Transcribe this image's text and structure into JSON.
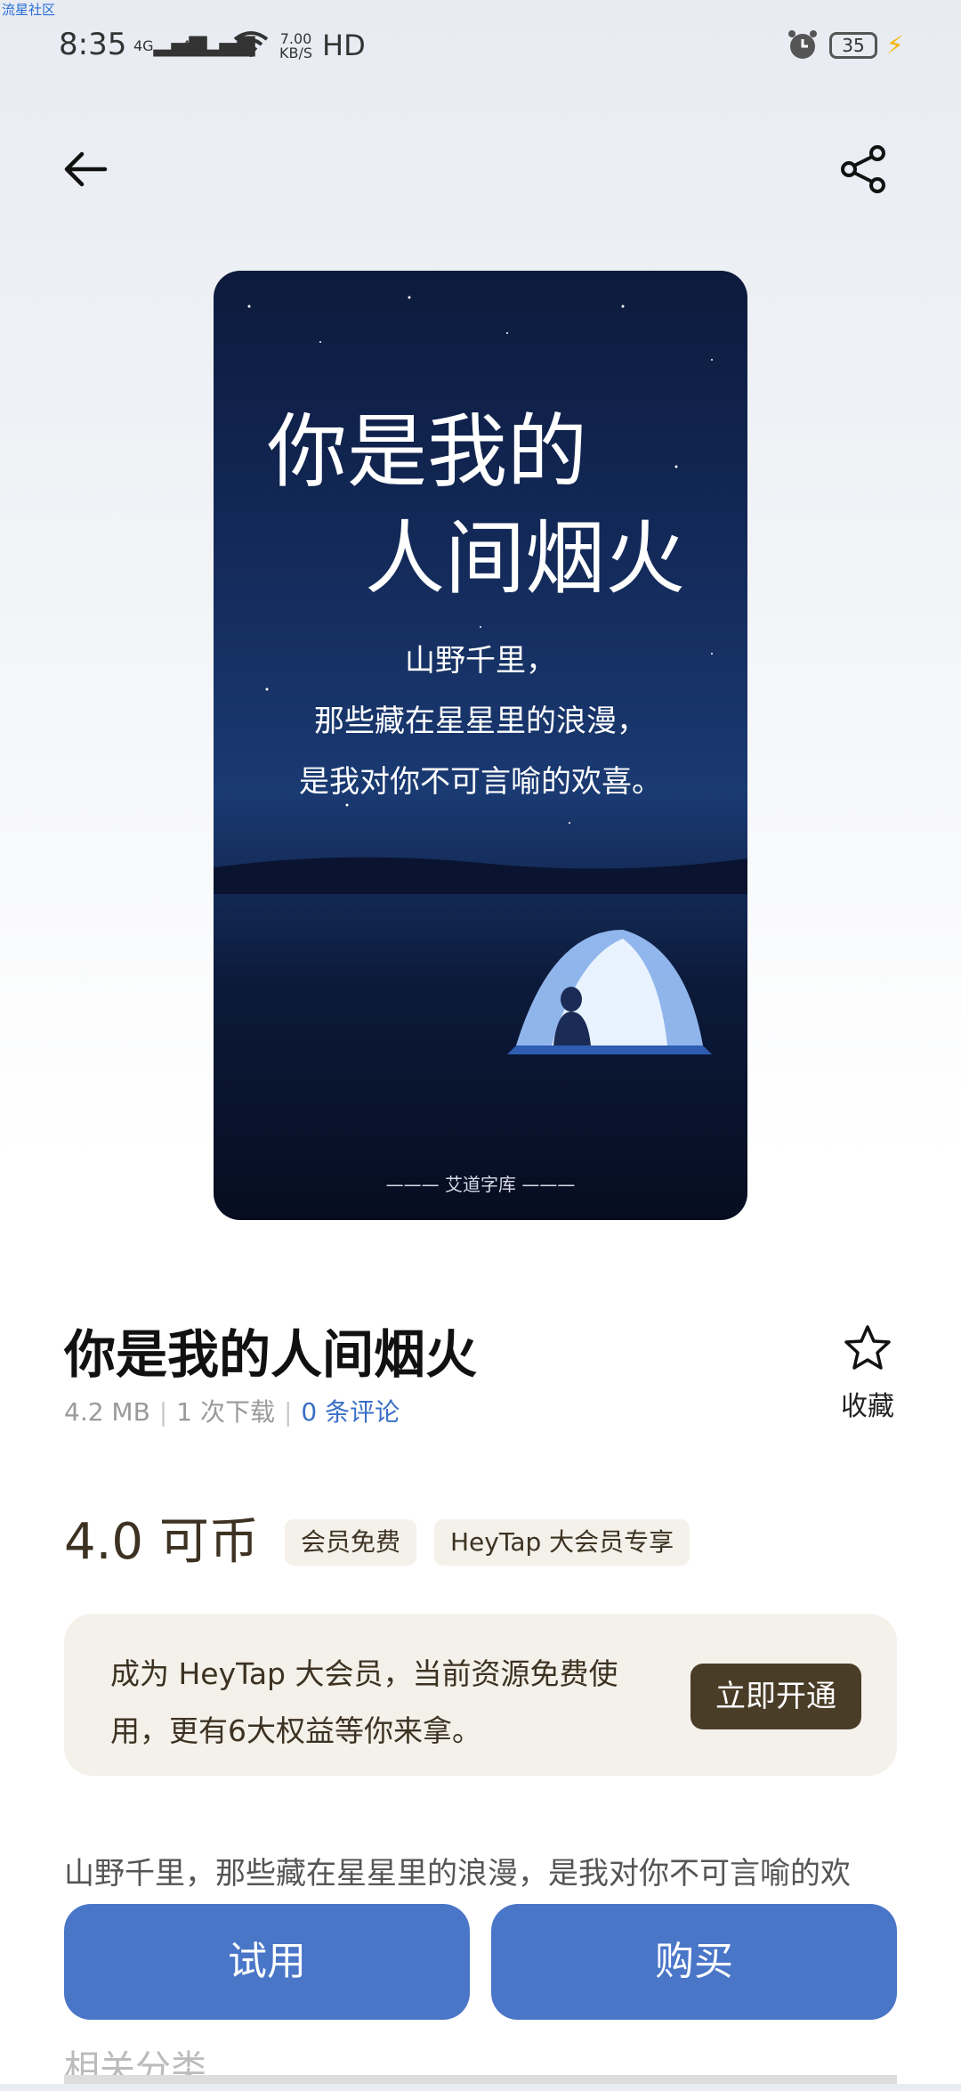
{
  "status_bar": {
    "watermark": "流星社区",
    "time": "8:35",
    "signal1": "4G",
    "signal2": "4G",
    "speed_value": "7.00",
    "speed_unit": "KB/S",
    "hd": "HD",
    "battery": "35"
  },
  "preview": {
    "title_line1": "你是我的",
    "title_line2": "人间烟火",
    "lines": [
      "山野千里，",
      "那些藏在星星里的浪漫，",
      "是我对你不可言喻的欢喜。"
    ],
    "signature": "艾道字库"
  },
  "resource": {
    "title": "你是我的人间烟火",
    "size": "4.2 MB",
    "downloads": "1 次下载",
    "comments": "0 条评论",
    "favorite_label": "收藏"
  },
  "price": {
    "value": "4.0 可币",
    "tags": [
      "会员免费",
      "HeyTap 大会员专享"
    ]
  },
  "banner": {
    "text": "成为 HeyTap 大会员，当前资源免费使用，更有6大权益等你来拿。",
    "button": "立即开通"
  },
  "description": "山野千里，那些藏在星星里的浪漫，是我对你不可言喻的欢",
  "related_title": "相关分类",
  "actions": {
    "try": "试用",
    "buy": "购买"
  },
  "colors": {
    "accent_blue": "#4a76c8",
    "gold_dark": "#4a3d28",
    "beige": "#f4f1ea"
  }
}
